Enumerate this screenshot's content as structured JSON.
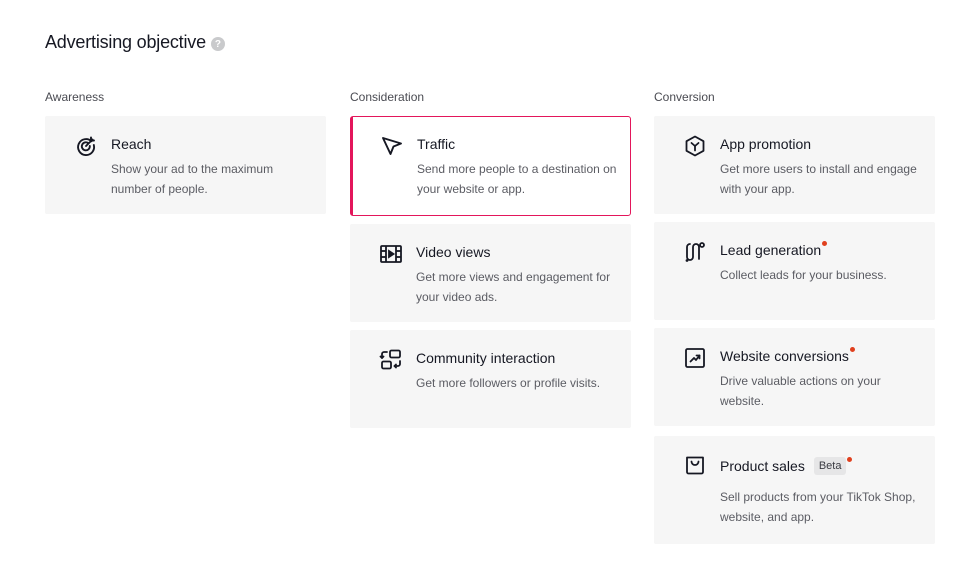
{
  "header": {
    "title": "Advertising objective",
    "help_glyph": "?"
  },
  "columns": [
    {
      "heading": "Awareness",
      "cards": [
        {
          "icon": "target-icon",
          "title": "Reach",
          "description": "Show your ad to the maximum number of people.",
          "selected": false
        }
      ]
    },
    {
      "heading": "Consideration",
      "cards": [
        {
          "icon": "cursor-arrow-icon",
          "title": "Traffic",
          "description": "Send more people to a destination on your website or app.",
          "selected": true
        },
        {
          "icon": "video-film-icon",
          "title": "Video views",
          "description": "Get more views and engagement for your video ads.",
          "selected": false
        },
        {
          "icon": "community-swap-icon",
          "title": "Community interaction",
          "description": "Get more followers or profile visits.",
          "selected": false
        }
      ]
    },
    {
      "heading": "Conversion",
      "cards": [
        {
          "icon": "app-cube-icon",
          "title": "App promotion",
          "description": "Get more users to install and engage with your app.",
          "selected": false
        },
        {
          "icon": "lead-path-icon",
          "title": "Lead generation",
          "description": "Collect leads for your business.",
          "selected": false,
          "new_dot": true
        },
        {
          "icon": "trend-chart-icon",
          "title": "Website conversions",
          "description": "Drive valuable actions on your website.",
          "selected": false,
          "new_dot": true
        },
        {
          "icon": "shopping-bag-icon",
          "title": "Product sales",
          "badge": "Beta",
          "description": "Sell products from your TikTok Shop, website, and app.",
          "selected": false,
          "new_dot": true
        }
      ]
    }
  ],
  "colors": {
    "selected_border": "#e3165b",
    "card_bg": "#f6f6f6",
    "new_dot": "#e0401e"
  }
}
